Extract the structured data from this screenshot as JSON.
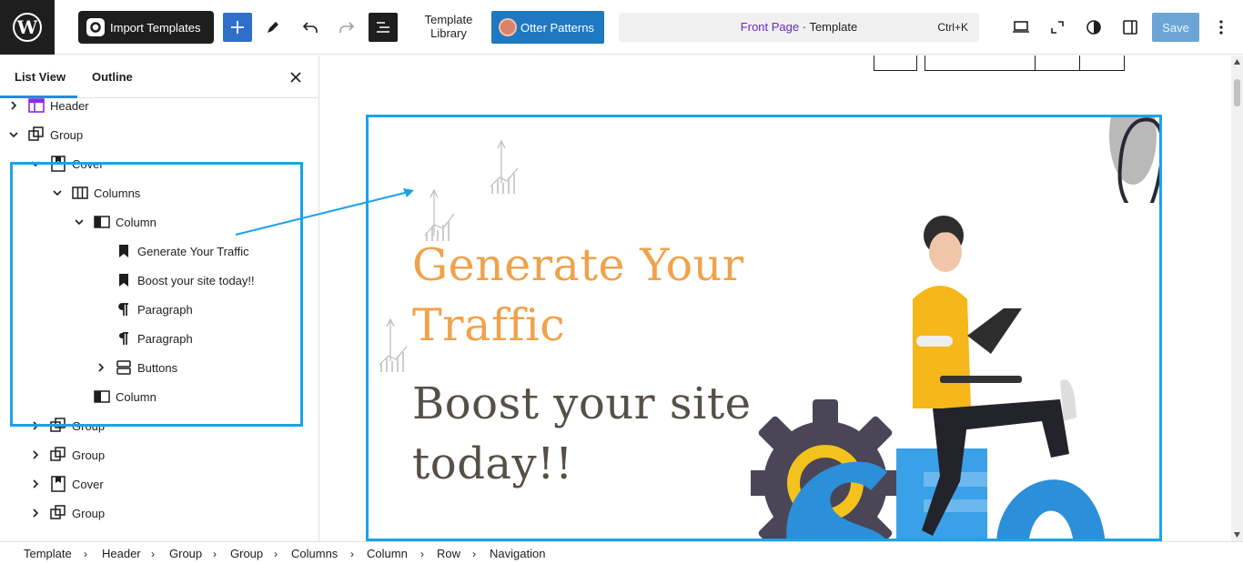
{
  "topbar": {
    "import_label": "Import Templates",
    "template_library_line1": "Template",
    "template_library_line2": "Library",
    "otter_label": "Otter Patterns",
    "doc_page": "Front Page",
    "doc_sep": " · ",
    "doc_type": "Template",
    "shortcut": "Ctrl+K",
    "save_label": "Save",
    "colors": {
      "accent": "#2f6fc9",
      "otter": "#1e78c2",
      "page_link": "#6a2bb8"
    }
  },
  "sidebar": {
    "tabs": [
      "List View",
      "Outline"
    ],
    "items": [
      {
        "label": "Header",
        "icon": "template-part-icon",
        "expanded": false
      },
      {
        "label": "Group",
        "icon": "group-icon",
        "expanded": true
      },
      {
        "label": "Cover",
        "icon": "cover-icon",
        "expanded": true
      },
      {
        "label": "Columns",
        "icon": "columns-icon",
        "expanded": true
      },
      {
        "label": "Column",
        "icon": "column-icon",
        "expanded": true
      },
      {
        "label": "Generate Your Traffic",
        "icon": "bookmark-icon"
      },
      {
        "label": "Boost your site today!!",
        "icon": "bookmark-icon"
      },
      {
        "label": "Paragraph",
        "icon": "paragraph-icon"
      },
      {
        "label": "Paragraph",
        "icon": "paragraph-icon"
      },
      {
        "label": "Buttons",
        "icon": "buttons-icon",
        "expanded": false
      },
      {
        "label": "Column",
        "icon": "column-icon"
      },
      {
        "label": "Group",
        "icon": "group-icon",
        "expanded": false
      },
      {
        "label": "Group",
        "icon": "group-icon",
        "expanded": false
      },
      {
        "label": "Cover",
        "icon": "cover-icon",
        "expanded": false
      },
      {
        "label": "Group",
        "icon": "group-icon",
        "expanded": false
      }
    ]
  },
  "canvas": {
    "heading1": "Generate Your Traffic",
    "heading2": "Boost your site today!!",
    "colors": {
      "heading1": "#f0a24a",
      "heading2": "#555047",
      "annotation": "#1aa3e8"
    }
  },
  "breadcrumbs": [
    "Template",
    "Header",
    "Group",
    "Group",
    "Columns",
    "Column",
    "Row",
    "Navigation"
  ]
}
